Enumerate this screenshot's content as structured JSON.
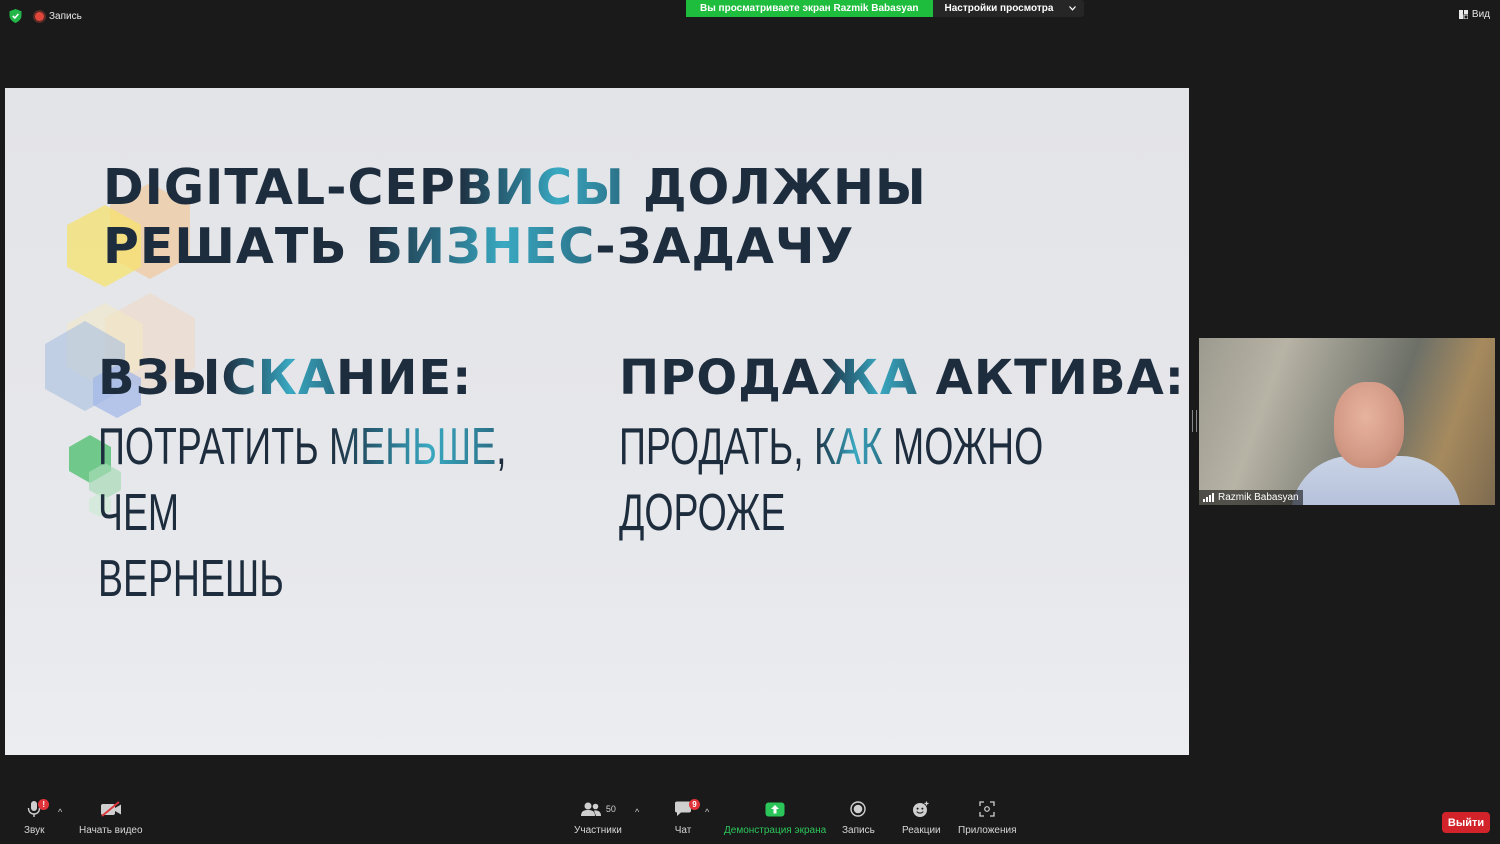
{
  "top_bar": {
    "recording_label": "Запись",
    "viewing_banner": "Вы просматриваете экран Razmik Babasyan",
    "view_settings": "Настройки просмотра",
    "view_button": "Вид"
  },
  "slide": {
    "title_line1_a": "DIGITAL-СЕР",
    "title_line1_b": "ВИСЫ",
    "title_line1_c": " ДОЛЖНЫ",
    "title_line2_a": "РЕШАТЬ ",
    "title_line2_b": "БИЗНЕС",
    "title_line2_c": "-ЗАДАЧУ",
    "left_heading_a": "ВЗЫ",
    "left_heading_b": "СКА",
    "left_heading_c": "НИЕ:",
    "left_body_line1_a": "ПОТРАТИТЬ ",
    "left_body_line1_b": "МЕНЬШЕ",
    "left_body_line1_c": ", ЧЕМ",
    "left_body_line2": "ВЕРНЕШЬ",
    "right_heading_a": "ПРОДА",
    "right_heading_b": "ЖА",
    "right_heading_c": " АКТИВА:",
    "right_body_line1_a": "ПРОДАТЬ, ",
    "right_body_line1_b": "КАК",
    "right_body_line1_c": " МОЖНО",
    "right_body_line2": "ДОРОЖЕ"
  },
  "video": {
    "participant_name": "Razmik Babasyan"
  },
  "toolbar": {
    "audio_label": "Звук",
    "audio_badge": "!",
    "video_label": "Начать видео",
    "participants_label": "Участники",
    "participants_count": "50",
    "chat_label": "Чат",
    "chat_badge": "9",
    "share_label": "Демонстрация экрана",
    "record_label": "Запись",
    "reactions_label": "Реакции",
    "apps_label": "Приложения",
    "leave_label": "Выйти"
  },
  "colors": {
    "share_green": "#2bc55a",
    "leave_red": "#d2232a",
    "banner_green": "#1fbd3e",
    "slide_dark": "#1e2d3e",
    "slide_teal": "#39a9c1"
  }
}
